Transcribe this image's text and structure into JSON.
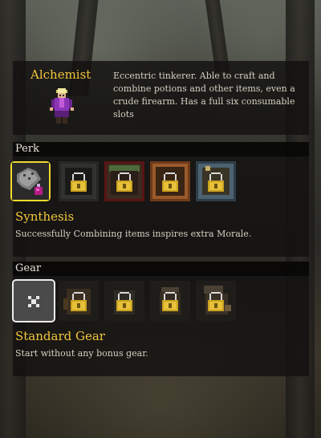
{
  "character": {
    "name": "Alchemist",
    "description": "Eccentric tinkerer. Able to craft and combine potions and other items, even a crude firearm. Has a full six consumable slots"
  },
  "perk": {
    "section_title": "Perk",
    "selected_name": "Synthesis",
    "selected_description": "Successfully Combining items inspires extra Morale.",
    "slots": [
      {
        "icon": "synthesis-icon",
        "locked": false,
        "selected": true
      },
      {
        "icon": "lock-icon",
        "locked": true,
        "selected": false
      },
      {
        "icon": "lock-icon",
        "locked": true,
        "selected": false
      },
      {
        "icon": "lock-icon",
        "locked": true,
        "selected": false
      },
      {
        "icon": "lock-icon",
        "locked": true,
        "selected": false
      }
    ]
  },
  "gear": {
    "section_title": "Gear",
    "selected_name": "Standard Gear",
    "selected_description": "Start without any bonus gear.",
    "slots": [
      {
        "icon": "none-x-icon",
        "locked": false,
        "selected": true
      },
      {
        "icon": "lock-icon",
        "locked": true,
        "selected": false
      },
      {
        "icon": "lock-icon",
        "locked": true,
        "selected": false
      },
      {
        "icon": "lock-icon",
        "locked": true,
        "selected": false
      },
      {
        "icon": "lock-icon",
        "locked": true,
        "selected": false
      }
    ]
  },
  "colors": {
    "accent_gold": "#f3c63a",
    "select_yellow": "#f0da2c",
    "select_white": "#ececec",
    "text": "#d6d0c3"
  }
}
